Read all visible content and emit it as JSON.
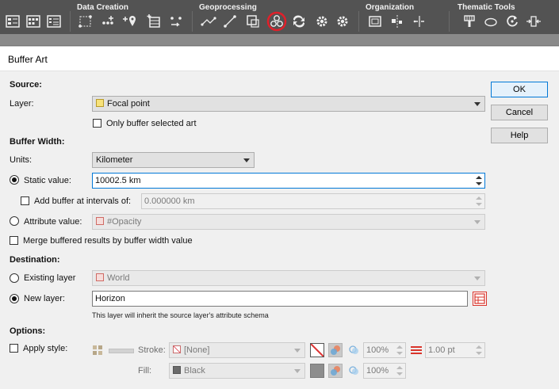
{
  "toolbar": {
    "groups": [
      {
        "title": "Data Creation"
      },
      {
        "title": "Geoprocessing"
      },
      {
        "title": "Organization"
      },
      {
        "title": "Thematic Tools"
      }
    ]
  },
  "dialog": {
    "title": "Buffer Art",
    "source": {
      "heading": "Source:",
      "layer_label": "Layer:",
      "layer_value": "Focal point",
      "only_selected_label": "Only buffer selected art",
      "only_selected_checked": false
    },
    "buffer_width": {
      "heading": "Buffer Width:",
      "units_label": "Units:",
      "units_value": "Kilometer",
      "static_label": "Static value:",
      "static_value": "10002.5 km",
      "intervals_label": "Add buffer at intervals of:",
      "intervals_value": "0.000000 km",
      "attribute_label": "Attribute value:",
      "attribute_value": "#Opacity",
      "merge_label": "Merge buffered results by buffer width value"
    },
    "destination": {
      "heading": "Destination:",
      "existing_label": "Existing layer",
      "existing_value": "World",
      "new_label": "New layer:",
      "new_value": "Horizon",
      "note": "This layer will inherit the source layer's attribute schema"
    },
    "options": {
      "heading": "Options:",
      "apply_style_label": "Apply style:",
      "stroke_label": "Stroke:",
      "stroke_value": "[None]",
      "stroke_opacity": "100%",
      "stroke_weight": "1.00 pt",
      "fill_label": "Fill:",
      "fill_value": "Black",
      "fill_opacity": "100%"
    },
    "buttons": {
      "ok": "OK",
      "cancel": "Cancel",
      "help": "Help"
    }
  },
  "colors": {
    "toolbar_bg": "#535353",
    "highlight_ring": "#e0202a",
    "focus_blue": "#0078d7",
    "layer_icon_red": "#d9342b"
  }
}
